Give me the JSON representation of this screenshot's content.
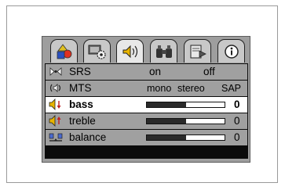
{
  "tabs": [
    {
      "icon": "shapes-icon",
      "active": false
    },
    {
      "icon": "monitor-gear-icon",
      "active": false
    },
    {
      "icon": "speaker-sound-icon",
      "active": true
    },
    {
      "icon": "binoculars-icon",
      "active": false
    },
    {
      "icon": "document-arrow-icon",
      "active": false
    },
    {
      "icon": "info-icon",
      "active": false
    }
  ],
  "audio_menu": {
    "srs": {
      "icon": "srs-icon",
      "label": "SRS",
      "options": [
        "on",
        "off"
      ]
    },
    "mts": {
      "icon": "mts-icon",
      "label": "MTS",
      "options": [
        "mono",
        "stereo",
        "SAP"
      ]
    },
    "bass": {
      "icon": "speaker-down-icon",
      "label": "bass",
      "value": "0",
      "level": 0.5,
      "selected": true
    },
    "treble": {
      "icon": "speaker-up-icon",
      "label": "treble",
      "value": "0",
      "level": 0.5
    },
    "balance": {
      "icon": "balance-icon",
      "label": "balance",
      "value": "0",
      "level": 0.5
    }
  },
  "colors": {
    "panel": "#9e9e9e",
    "row": "#a0a0a0",
    "selected_row": "#ffffff",
    "slider_fill": "#2a2a2a"
  }
}
